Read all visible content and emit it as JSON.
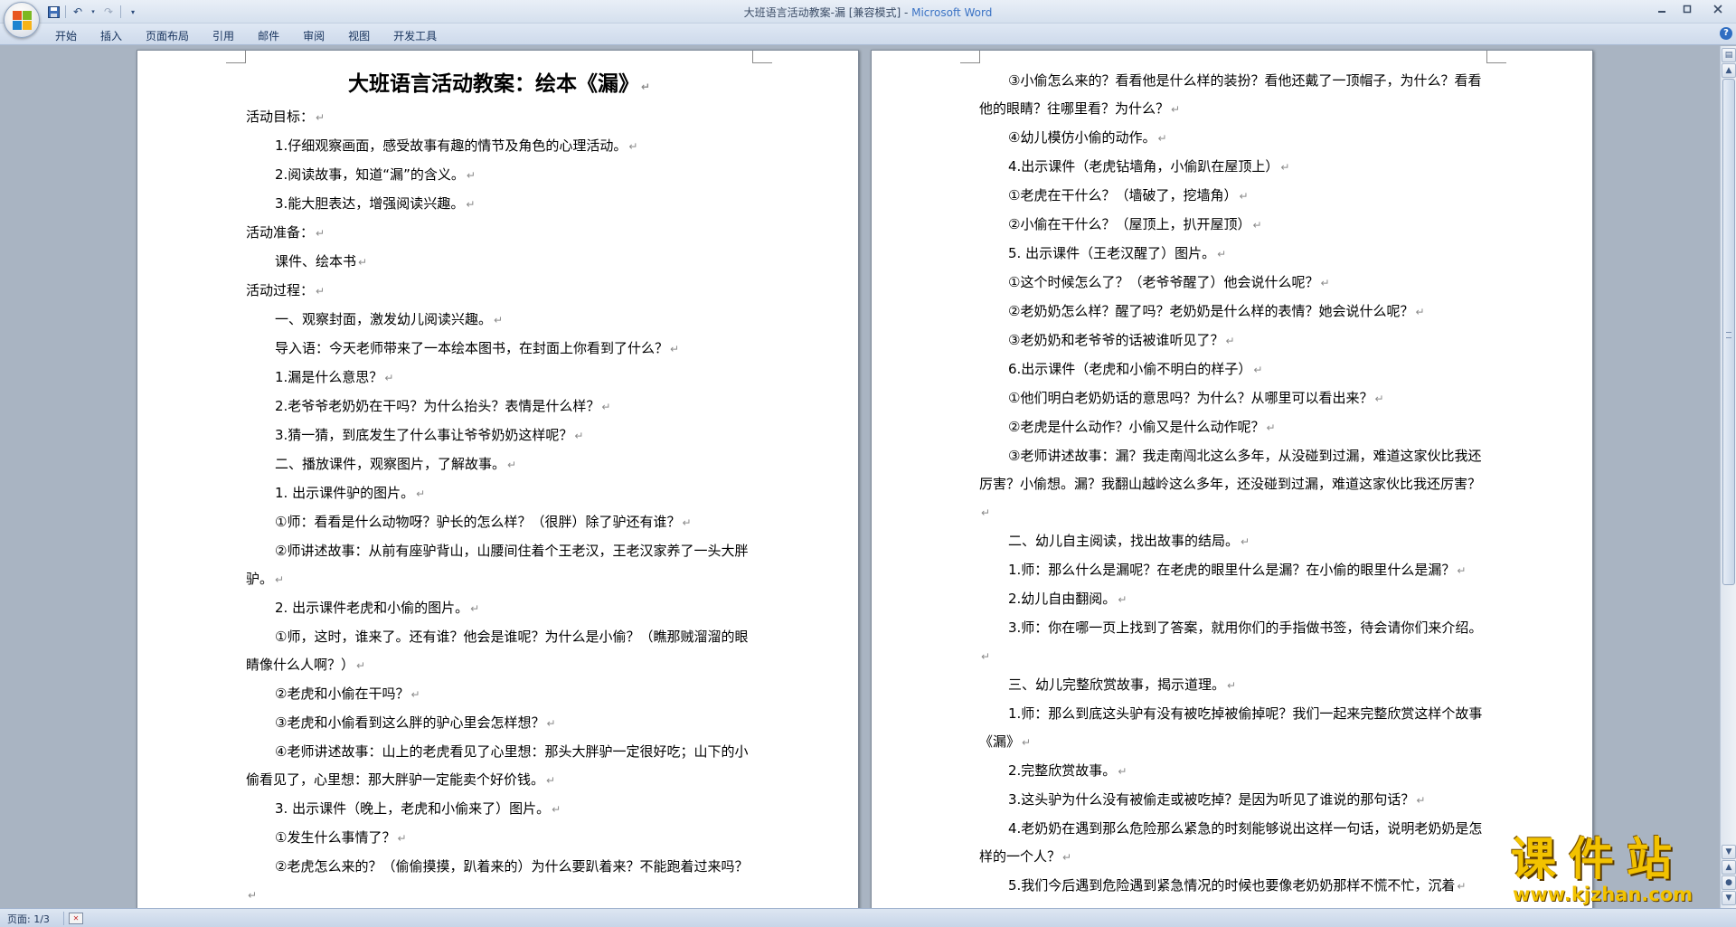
{
  "window": {
    "title": "大班语言活动教案-漏 [兼容模式] - ",
    "app_name": "Microsoft Word"
  },
  "quick_access": {
    "save_icon": "save-icon",
    "undo_icon": "undo-icon",
    "redo_icon": "redo-icon",
    "customize_icon": "customize-dropdown-icon"
  },
  "ribbon": {
    "tabs": [
      "开始",
      "插入",
      "页面布局",
      "引用",
      "邮件",
      "审阅",
      "视图",
      "开发工具"
    ],
    "help": "?"
  },
  "document": {
    "left_page": [
      {
        "text": "大班语言活动教案：绘本《漏》",
        "style": "title"
      },
      {
        "text": "活动目标：",
        "style": "plain"
      },
      {
        "text": "1.仔细观察画面，感受故事有趣的情节及角色的心理活动。",
        "style": "indent"
      },
      {
        "text": "2.阅读故事，知道“漏”的含义。",
        "style": "indent"
      },
      {
        "text": "3.能大胆表达，增强阅读兴趣。",
        "style": "indent"
      },
      {
        "text": "活动准备：",
        "style": "plain"
      },
      {
        "text": "课件、绘本书",
        "style": "indent"
      },
      {
        "text": "活动过程：",
        "style": "plain"
      },
      {
        "text": "一、观察封面，激发幼儿阅读兴趣。",
        "style": "indent"
      },
      {
        "text": "导入语：今天老师带来了一本绘本图书，在封面上你看到了什么？",
        "style": "indent"
      },
      {
        "text": "1.漏是什么意思？",
        "style": "indent"
      },
      {
        "text": "2.老爷爷老奶奶在干吗？为什么抬头？表情是什么样？",
        "style": "indent"
      },
      {
        "text": "3.猜一猜，到底发生了什么事让爷爷奶奶这样呢？",
        "style": "indent"
      },
      {
        "text": "二、播放课件，观察图片，了解故事。",
        "style": "indent"
      },
      {
        "text": "1. 出示课件驴的图片。",
        "style": "indent"
      },
      {
        "text": "①师：看看是什么动物呀？驴长的怎么样？（很胖）除了驴还有谁？",
        "style": "indent"
      },
      {
        "text": "②师讲述故事：从前有座驴背山，山腰间住着个王老汉，王老汉家养了一头大胖驴。",
        "style": "indent"
      },
      {
        "text": "2. 出示课件老虎和小偷的图片。",
        "style": "indent"
      },
      {
        "text": "①师，这时，谁来了。还有谁？他会是谁呢？为什么是小偷？（瞧那贼溜溜的眼睛像什么人啊？）",
        "style": "indent"
      },
      {
        "text": "②老虎和小偷在干吗？",
        "style": "indent"
      },
      {
        "text": "③老虎和小偷看到这么胖的驴心里会怎样想？",
        "style": "indent"
      },
      {
        "text": "④老师讲述故事：山上的老虎看见了心里想：那头大胖驴一定很好吃；山下的小偷看见了，心里想：那大胖驴一定能卖个好价钱。",
        "style": "indent"
      },
      {
        "text": "3. 出示课件（晚上，老虎和小偷来了）图片。",
        "style": "indent"
      },
      {
        "text": "①发生什么事情了？",
        "style": "indent"
      },
      {
        "text": "②老虎怎么来的？（偷偷摸摸，趴着来的）为什么要趴着来？不能跑着过来吗？",
        "style": "indent"
      }
    ],
    "right_page": [
      {
        "text": "③小偷怎么来的？看看他是什么样的装扮？看他还戴了一顶帽子，为什么？看看他的眼睛？往哪里看？为什么？",
        "style": "indent"
      },
      {
        "text": "④幼儿模仿小偷的动作。",
        "style": "indent"
      },
      {
        "text": "4.出示课件（老虎钻墙角，小偷趴在屋顶上）",
        "style": "indent"
      },
      {
        "text": "①老虎在干什么？（墙破了，挖墙角）",
        "style": "indent"
      },
      {
        "text": "②小偷在干什么？（屋顶上，扒开屋顶）",
        "style": "indent"
      },
      {
        "text": "5. 出示课件（王老汉醒了）图片。",
        "style": "indent"
      },
      {
        "text": "①这个时候怎么了？（老爷爷醒了）他会说什么呢？",
        "style": "indent"
      },
      {
        "text": "②老奶奶怎么样？醒了吗？老奶奶是什么样的表情？她会说什么呢？",
        "style": "indent"
      },
      {
        "text": "③老奶奶和老爷爷的话被谁听见了？",
        "style": "indent"
      },
      {
        "text": "6.出示课件（老虎和小偷不明白的样子）",
        "style": "indent"
      },
      {
        "text": "①他们明白老奶奶话的意思吗？为什么？从哪里可以看出来？",
        "style": "indent"
      },
      {
        "text": "②老虎是什么动作？小偷又是什么动作呢？",
        "style": "indent"
      },
      {
        "text": "③老师讲述故事：漏？我走南闯北这么多年，从没碰到过漏，难道这家伙比我还厉害？小偷想。漏？我翻山越岭这么多年，还没碰到过漏，难道这家伙比我还厉害？",
        "style": "indent"
      },
      {
        "text": "二、幼儿自主阅读，找出故事的结局。",
        "style": "indent"
      },
      {
        "text": "1.师：那么什么是漏呢？在老虎的眼里什么是漏？在小偷的眼里什么是漏？",
        "style": "indent"
      },
      {
        "text": "2.幼儿自由翻阅。",
        "style": "indent"
      },
      {
        "text": "3.师：你在哪一页上找到了答案，就用你们的手指做书签，待会请你们来介绍。",
        "style": "indent"
      },
      {
        "text": "三、幼儿完整欣赏故事，揭示道理。",
        "style": "indent"
      },
      {
        "text": "1.师：那么到底这头驴有没有被吃掉被偷掉呢？我们一起来完整欣赏这样个故事《漏》",
        "style": "indent"
      },
      {
        "text": "2.完整欣赏故事。",
        "style": "indent"
      },
      {
        "text": "3.这头驴为什么没有被偷走或被吃掉？是因为听见了谁说的那句话？",
        "style": "indent"
      },
      {
        "text": "4.老奶奶在遇到那么危险那么紧急的时刻能够说出这样一句话，说明老奶奶是怎样的一个人？",
        "style": "indent"
      },
      {
        "text": "5.我们今后遇到危险遇到紧急情况的时候也要像老奶奶那样不慌不忙，沉着",
        "style": "indent"
      }
    ],
    "paragraph_mark": "↵"
  },
  "statusbar": {
    "page_count": "页面: 1/3"
  },
  "watermark": {
    "chinese": "课件站",
    "url": "www.kjzhan.com"
  },
  "colors": {
    "app_name": "#3a72c4",
    "watermark": "#f2c200"
  }
}
